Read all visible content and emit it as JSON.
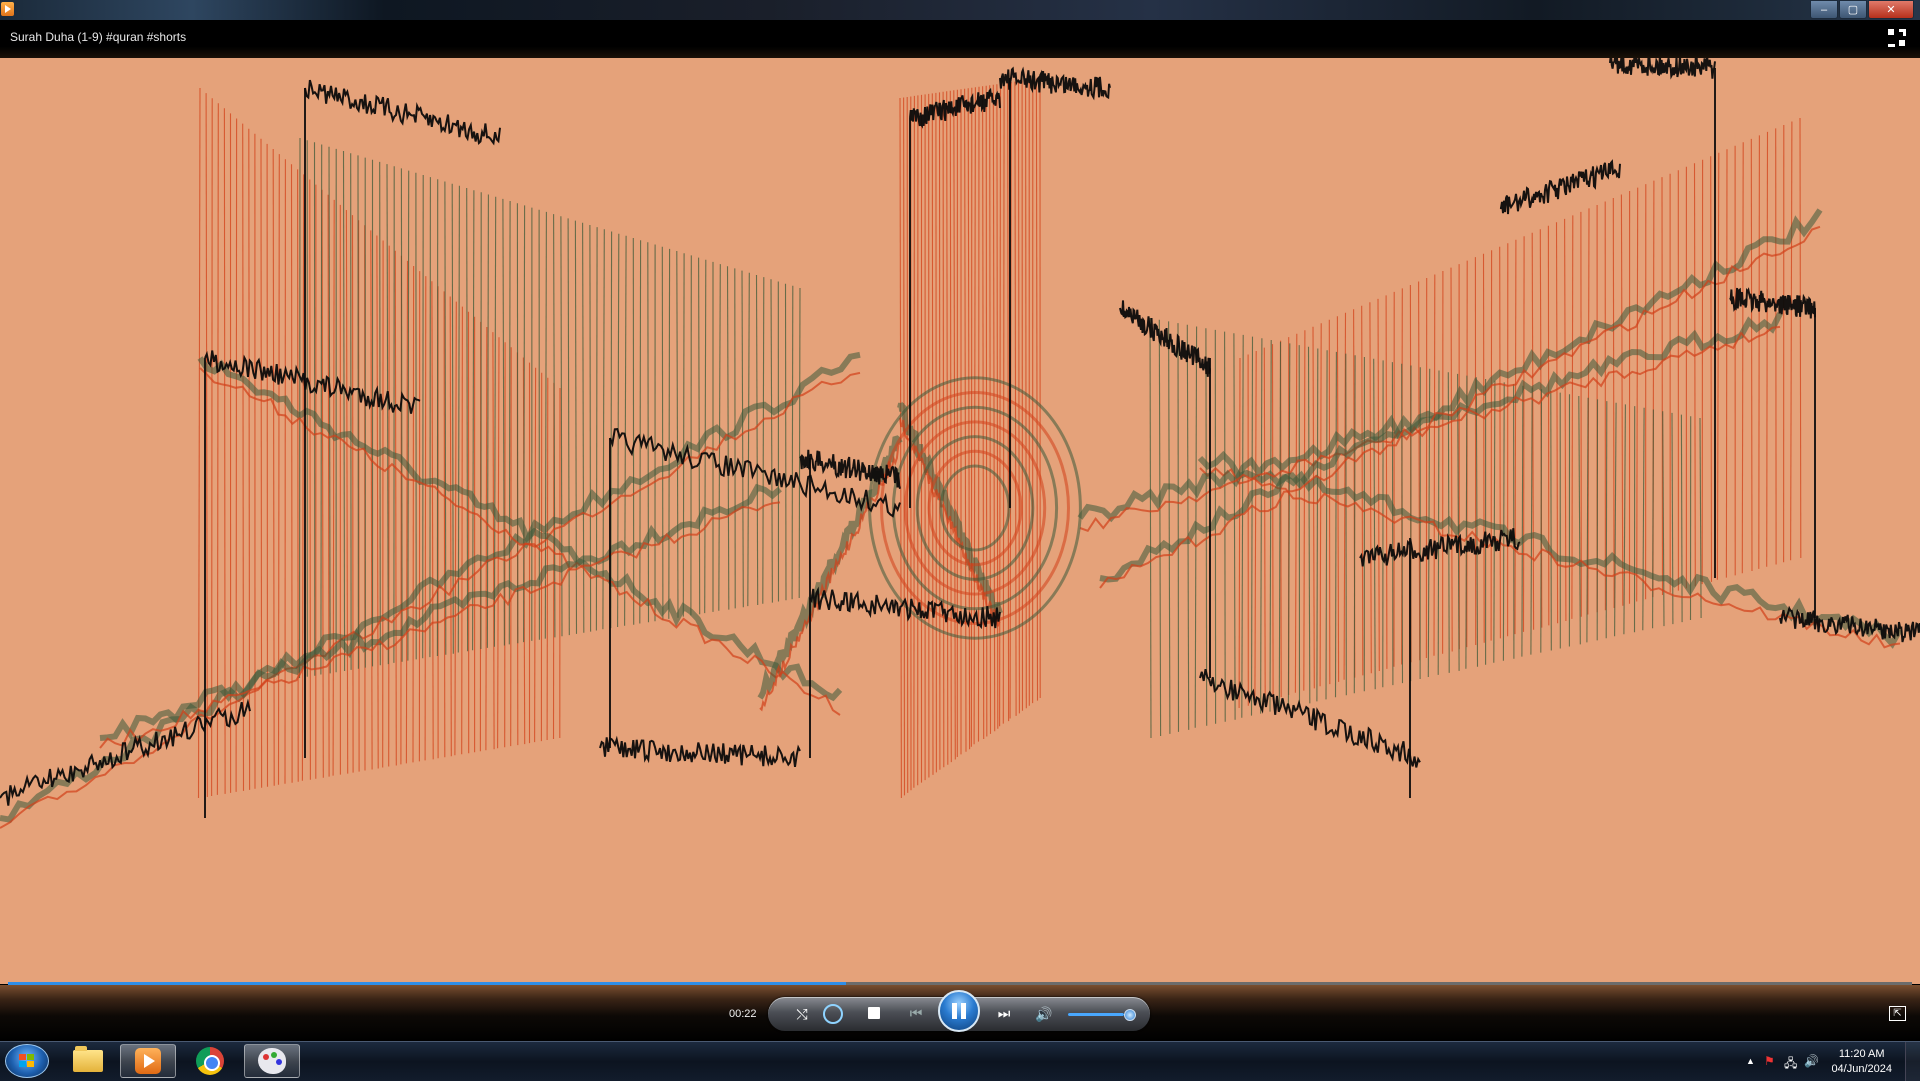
{
  "window": {
    "title": "Surah Duha (1-9) #quran #shorts",
    "minimize_glyph": "–",
    "maximize_glyph": "▢",
    "close_glyph": "✕"
  },
  "player": {
    "elapsed": "00:22",
    "progress_fraction": 0.44,
    "volume_fraction": 0.9,
    "shuffle_glyph": "⤭",
    "prev_glyph": "⏮",
    "next_glyph": "⏭",
    "volume_glyph": "🔊",
    "switch_glyph": "⇱",
    "state": "playing"
  },
  "taskbar": {
    "apps": [
      {
        "name": "windows-explorer",
        "icon": "folder-icon"
      },
      {
        "name": "windows-media-player",
        "icon": "media-player-icon",
        "active": true
      },
      {
        "name": "google-chrome",
        "icon": "chrome-icon"
      },
      {
        "name": "paint",
        "icon": "paint-icon"
      }
    ],
    "tray": {
      "show_hidden_glyph": "▲",
      "flag_glyph": "⚑",
      "network_glyph": "🖧",
      "volume_glyph": "🔊"
    },
    "clock_time": "11:20 AM",
    "clock_date": "04/Jun/2024"
  },
  "colors": {
    "video_background": "#e5a27a",
    "waveform_black": "#0b0b0b",
    "waveform_red": "#d2401a",
    "waveform_green": "#3d5a3a",
    "seek_fill": "#2f8ee8"
  }
}
